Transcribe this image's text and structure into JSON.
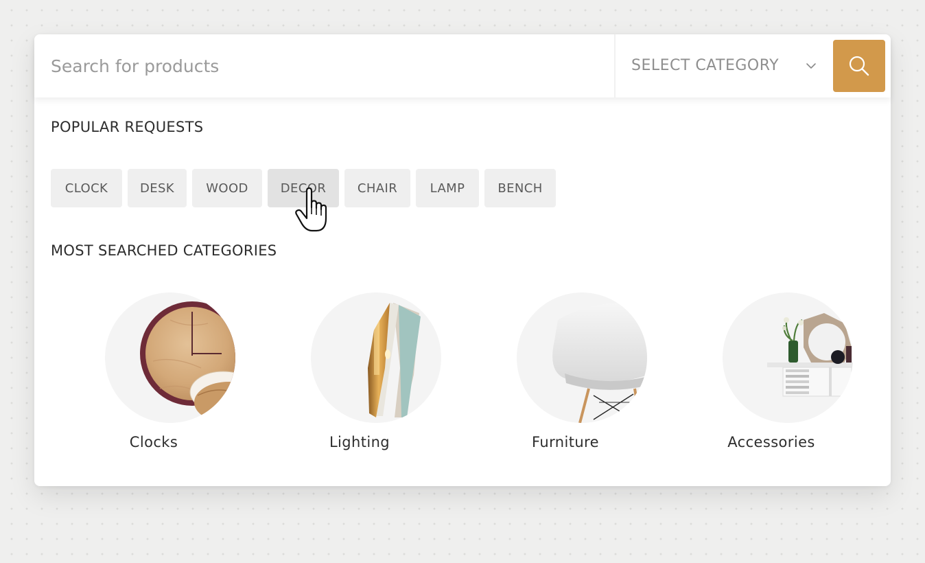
{
  "search": {
    "placeholder": "Search for products",
    "value": "",
    "category_label": "SELECT CATEGORY",
    "button_icon": "search-icon"
  },
  "popular": {
    "heading": "POPULAR REQUESTS",
    "chips": [
      "CLOCK",
      "DESK",
      "WOOD",
      "DECOR",
      "CHAIR",
      "LAMP",
      "BENCH"
    ],
    "hovered": "DECOR"
  },
  "categories": {
    "heading": "MOST SEARCHED CATEGORIES",
    "items": [
      {
        "name": "Clocks",
        "icon": "wooden-clock-image"
      },
      {
        "name": "Lighting",
        "icon": "lamp-image"
      },
      {
        "name": "Furniture",
        "icon": "chair-image"
      },
      {
        "name": "Accessories",
        "icon": "shelf-decor-image"
      }
    ]
  },
  "colors": {
    "accent": "#d2994b",
    "chip_bg": "#efefef",
    "chip_hover_bg": "#e2e2e2",
    "page_bg": "#efefee",
    "panel_bg": "#ffffff"
  }
}
